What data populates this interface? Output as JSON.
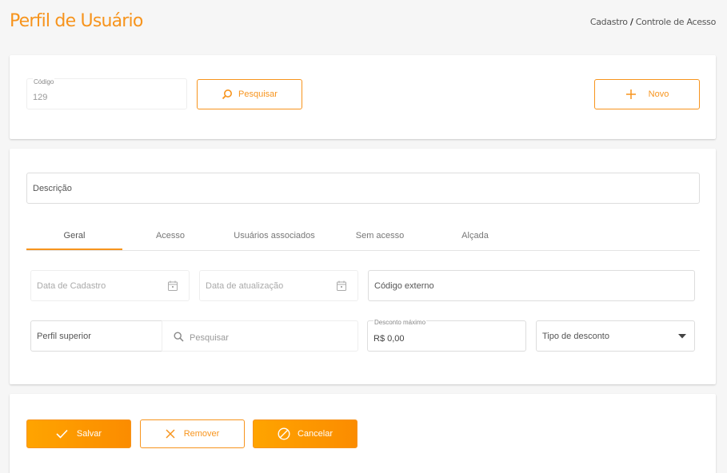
{
  "header": {
    "title": "Perfil de Usuário",
    "breadcrumb_parent": "Cadastro",
    "breadcrumb_sep": "/",
    "breadcrumb_current": "Controle de Acesso"
  },
  "search_card": {
    "codigo_label": "Código",
    "codigo_value": "129",
    "search_button": "Pesquisar",
    "new_button": "Novo"
  },
  "form": {
    "descricao_label": "Descrição",
    "tabs": [
      {
        "label": "Geral",
        "active": true
      },
      {
        "label": "Acesso",
        "active": false
      },
      {
        "label": "Usuários associados",
        "active": false
      },
      {
        "label": "Sem acesso",
        "active": false
      },
      {
        "label": "Alçada",
        "active": false
      }
    ],
    "data_cadastro_label": "Data de Cadastro",
    "data_atualizacao_label": "Data de atualização",
    "codigo_externo_label": "Código externo",
    "perfil_superior_label": "Perfil superior",
    "perfil_search_placeholder": "Pesquisar",
    "desconto_label": "Desconto máximo",
    "desconto_value": "R$ 0,00",
    "tipo_desconto_label": "Tipo de desconto"
  },
  "actions": {
    "save": "Salvar",
    "remove": "Remover",
    "cancel": "Cancelar"
  },
  "colors": {
    "accent": "#f7941d",
    "accent_gradient_start": "#ffa400",
    "accent_gradient_end": "#fb8c00"
  }
}
